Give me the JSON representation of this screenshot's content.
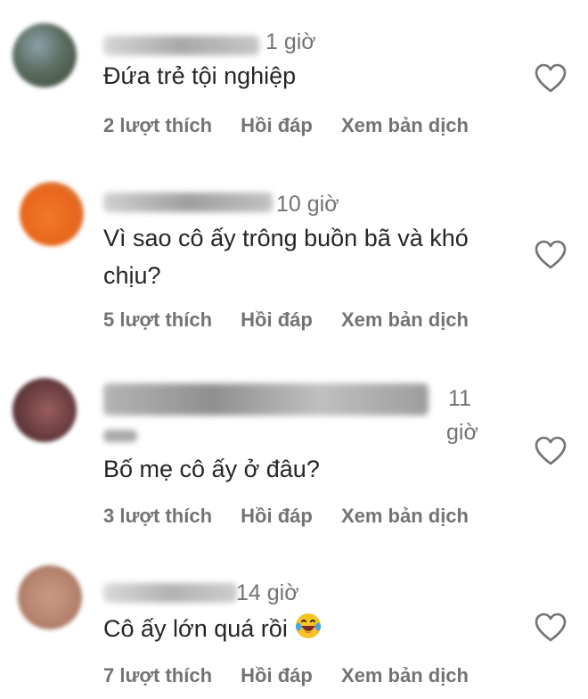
{
  "comments": [
    {
      "time": "1 giờ",
      "text": "Đứa trẻ tội nghiệp",
      "likes": "2 lượt thích",
      "reply": "Hồi đáp",
      "translate": "Xem bản dịch"
    },
    {
      "time": "10 giờ",
      "text": "Vì sao cô ấy trông buồn bã và khó chịu?",
      "likes": "5 lượt thích",
      "reply": "Hồi đáp",
      "translate": "Xem bản dịch"
    },
    {
      "time_line1": "11",
      "time_line2": "giờ",
      "text": "Bố mẹ cô ấy ở đâu?",
      "likes": "3 lượt thích",
      "reply": "Hồi đáp",
      "translate": "Xem bản dịch"
    },
    {
      "time": "14 giờ",
      "text": "Cô ấy lớn quá rồi",
      "emoji": "laughing-tears-emoji",
      "likes": "7 lượt thích",
      "reply": "Hồi đáp",
      "translate": "Xem bản dịch"
    }
  ],
  "icons": {
    "like": "heart-outline-icon"
  },
  "colors": {
    "text": "#262626",
    "secondary": "#737373"
  }
}
